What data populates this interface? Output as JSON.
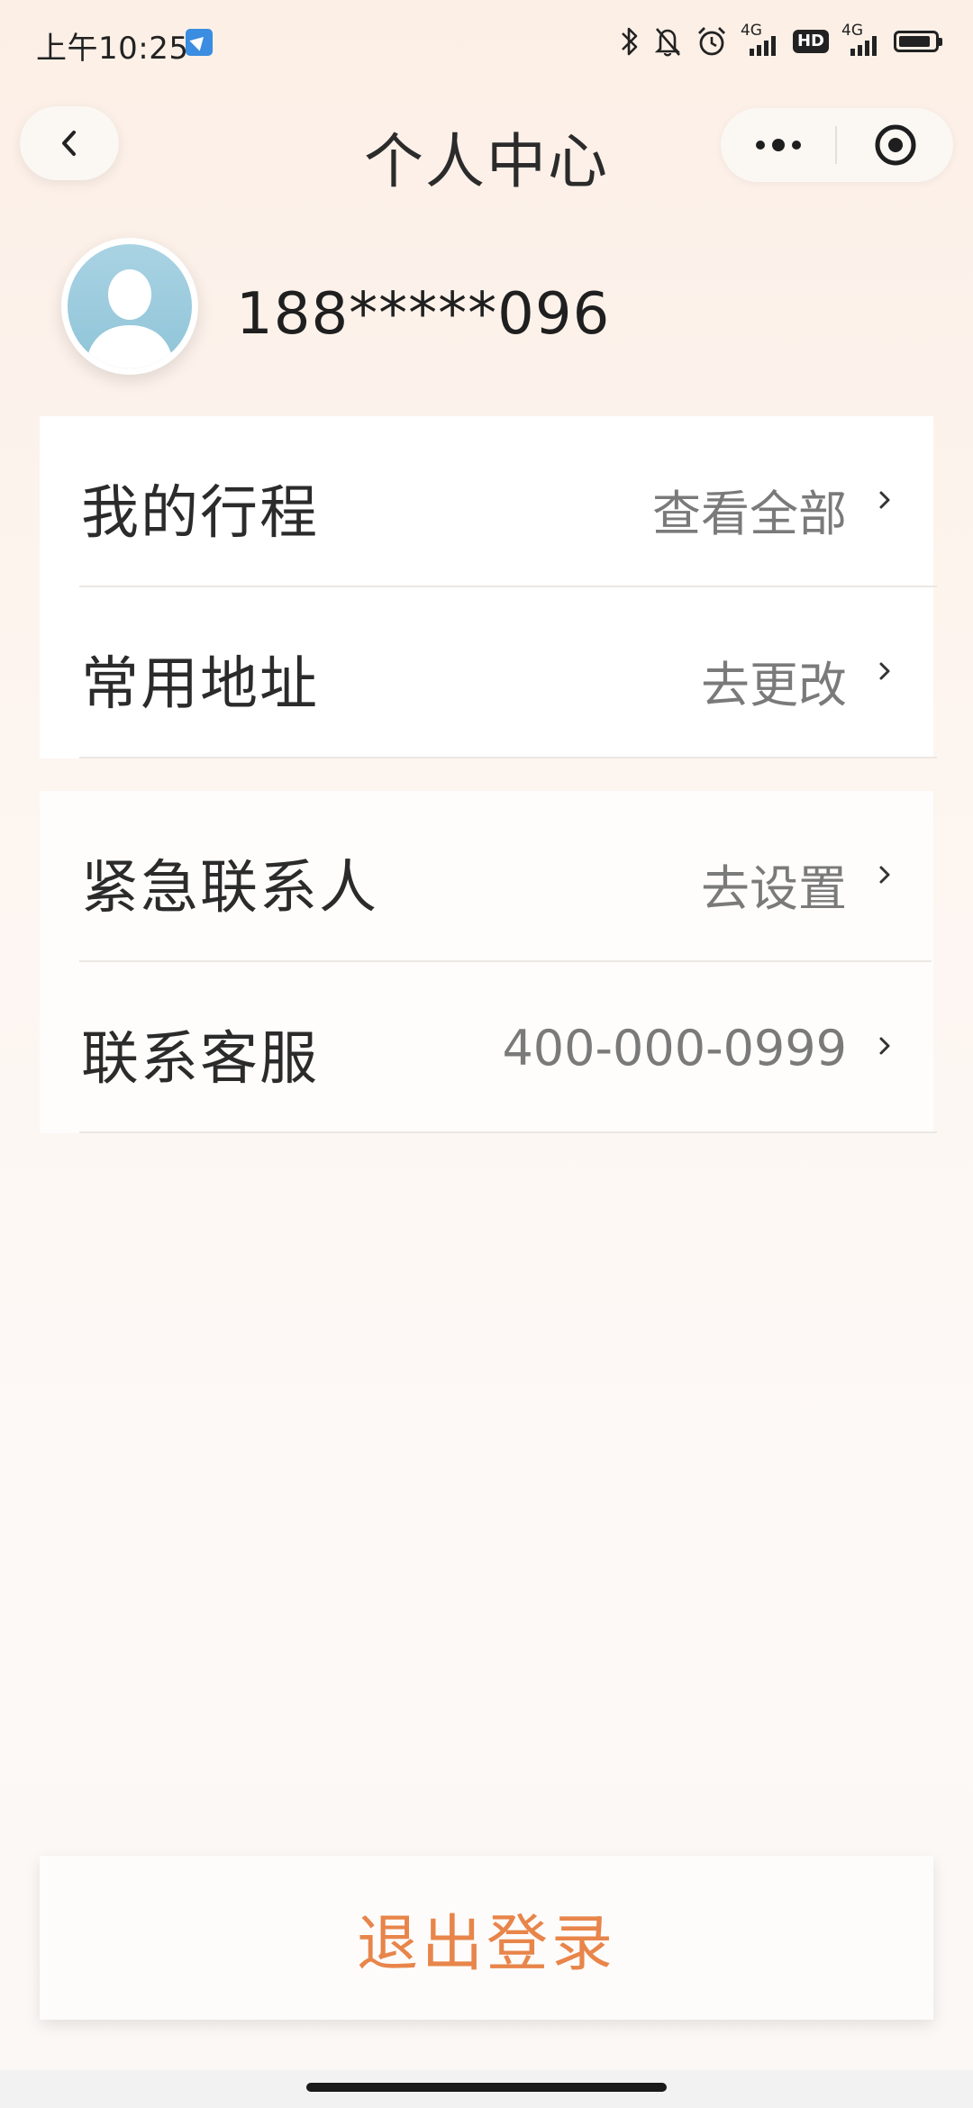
{
  "status_bar": {
    "time": "上午10:25",
    "network_label": "4G",
    "hd_label": "HD"
  },
  "header": {
    "title": "个人中心"
  },
  "profile": {
    "phone": "188*****096"
  },
  "menu_group_1": [
    {
      "label": "我的行程",
      "value": "查看全部"
    },
    {
      "label": "常用地址",
      "value": "去更改"
    }
  ],
  "menu_group_2": [
    {
      "label": "紧急联系人",
      "value": "去设置"
    },
    {
      "label": "联系客服",
      "value": "400-000-0999"
    }
  ],
  "logout": {
    "label": "退出登录"
  },
  "colors": {
    "accent": "#e8854a",
    "avatar_bg": "#8fc4d8"
  }
}
